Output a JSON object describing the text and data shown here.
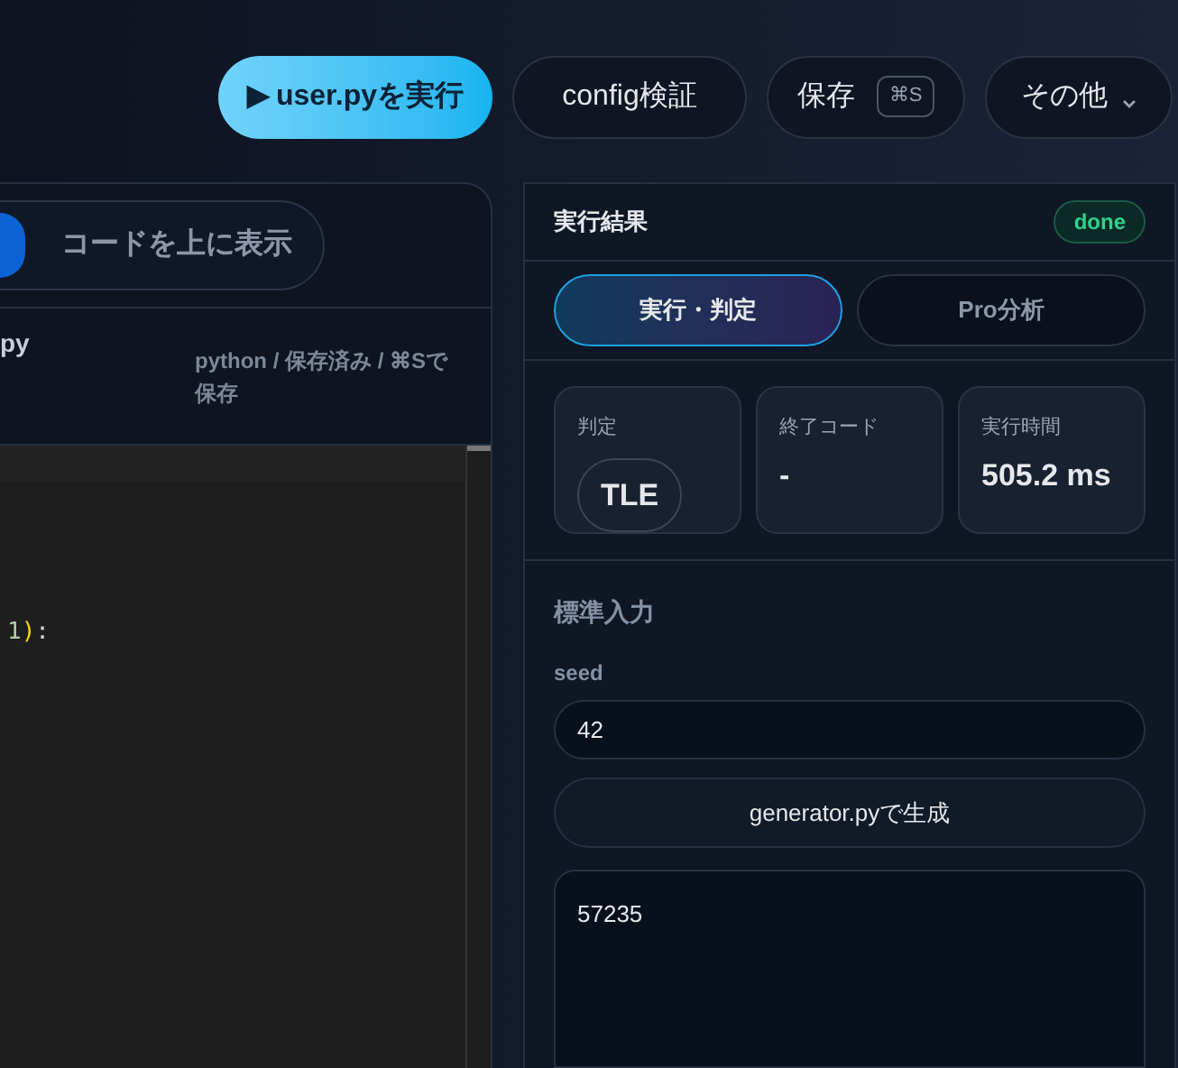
{
  "toolbar": {
    "buttons": [
      {
        "label": "user.pyを実行",
        "icon": "▶",
        "kind": "primary"
      },
      {
        "label": "config検証",
        "kind": "plain"
      },
      {
        "label": "保存",
        "shortcut": "⌘S",
        "kind": "shortcut"
      },
      {
        "label": "その他",
        "kind": "menu"
      }
    ]
  },
  "editor_panel": {
    "toggle": {
      "label": "コードを上に表示",
      "on": true
    },
    "file_name": "py",
    "meta": "python / 保存済み / ⌘Sで保存",
    "code_lines": [
      {
        "tokens": [
          {
            "text": "1",
            "color": "#b5cea8"
          },
          {
            "text": ")",
            "color": "#ffd700"
          },
          {
            "text": ":",
            "color": "#d4d4d4"
          }
        ]
      }
    ]
  },
  "result_panel": {
    "title": "実行結果",
    "status": "done",
    "tabs": [
      {
        "label": "実行・判定",
        "selected": true
      },
      {
        "label": "Pro分析",
        "selected": false
      }
    ],
    "stats": [
      {
        "label": "判定",
        "value": "TLE",
        "kind": "badge"
      },
      {
        "label": "終了コード",
        "value": "-",
        "kind": "text"
      },
      {
        "label": "実行時間",
        "value": "505.2 ms",
        "kind": "text"
      }
    ],
    "stdin": {
      "heading": "標準入力",
      "seed_label": "seed",
      "seed_value": "42",
      "generate_button": "generator.pyで生成",
      "input_value": "57235"
    }
  }
}
